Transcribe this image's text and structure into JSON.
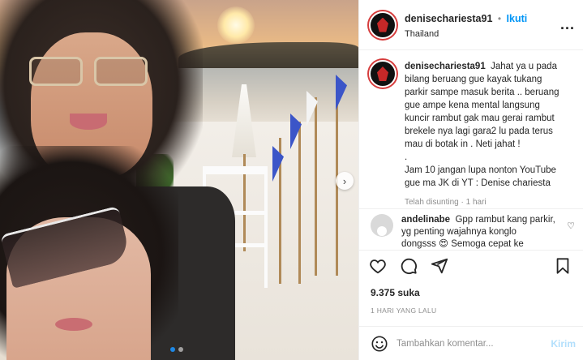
{
  "post": {
    "username": "denisechariesta91",
    "separator": "•",
    "follow_label": "Ikuti",
    "location": "Thailand",
    "more_label": "...",
    "caption_lines": [
      "Jahat ya u pada",
      "bilang beruang gue kayak tukang",
      "parkir sampe masuk berita .. beruang",
      "gue ampe kena mental langsung",
      "kuncir rambut gak mau gerai rambut",
      "brekele nya lagi gara2 lu pada terus",
      "mau di botak in . Neti jahat !",
      ".",
      "Jam 10 jangan lupa nonton YouTube",
      "gue ma JK di YT : Denise chariesta"
    ],
    "edited_label": "Telah disunting",
    "edited_sep": "·",
    "edited_time": "1 hari",
    "likes": "9.375 suka",
    "timestamp": "1 HARI YANG LALU"
  },
  "comment": {
    "username": "andelinabe",
    "lines": [
      "Gpp rambut kang parkir,",
      "yg penting wajahnya konglo",
      "dongsss 😍 Semoga cepat ke"
    ],
    "like_icon": "♡"
  },
  "add_comment": {
    "placeholder": "Tambahkan komentar...",
    "post_label": "Kirim"
  },
  "carousel": {
    "next_icon": "›",
    "total": 2,
    "active": 1
  },
  "colors": {
    "link": "#0095f6",
    "post_disabled": "#b2dffc",
    "muted": "#8e8e8e"
  }
}
